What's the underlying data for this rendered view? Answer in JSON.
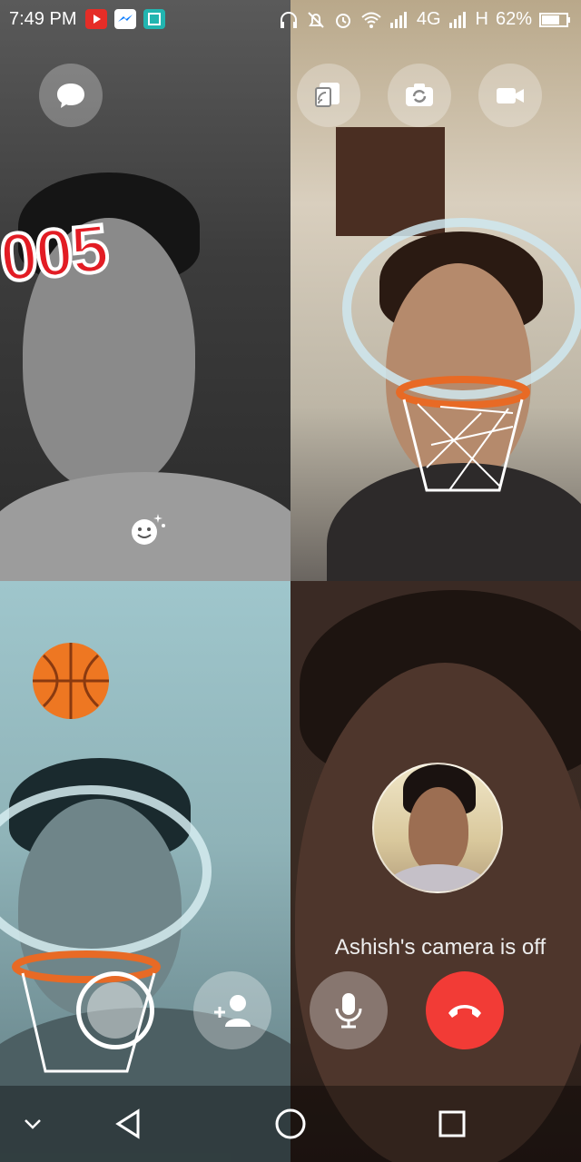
{
  "status_bar": {
    "time": "7:49 PM",
    "network": "4G",
    "network2": "H",
    "battery": "62%",
    "app_icons": [
      "youtube-icon",
      "messenger-icon",
      "screenshot-icon"
    ],
    "indicator_icons": [
      "headset-icon",
      "mute-bell-icon",
      "alarm-icon",
      "wifi-icon",
      "signal-icon",
      "battery-icon"
    ]
  },
  "top_controls": {
    "chat": "chat-bubble-icon",
    "screen_share": "screen-share-icon",
    "flip_camera": "flip-camera-icon",
    "video": "video-camera-icon"
  },
  "game": {
    "score": "005"
  },
  "effects_button": "smiley-effects-icon",
  "call": {
    "camera_off_notice": "Ashish's camera is off"
  },
  "bottom_controls": {
    "capture": "capture-shutter-icon",
    "add_person": "add-person-icon",
    "mic": "microphone-icon",
    "end_call": "end-call-icon"
  },
  "colors": {
    "end_call": "#f23b36",
    "score_red": "#e21c24",
    "ball_orange": "#ee7722"
  },
  "nav": [
    "chevron-down-icon",
    "back-icon",
    "home-icon",
    "recents-icon"
  ]
}
